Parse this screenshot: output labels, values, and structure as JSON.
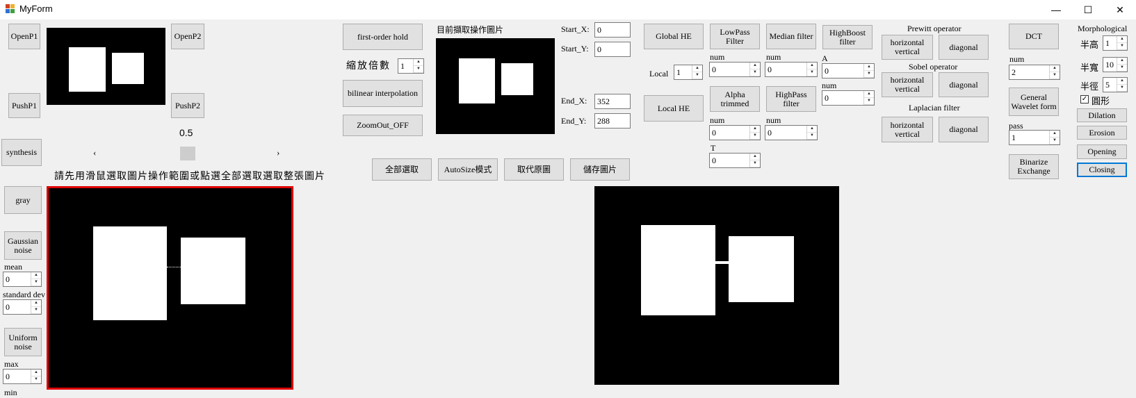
{
  "window": {
    "title": "MyForm",
    "minimize": "—",
    "maximize": "☐",
    "close": "✕"
  },
  "buttons": {
    "openp1": "OpenP1",
    "openp2": "OpenP2",
    "pushp1": "PushP1",
    "pushp2": "PushP2",
    "synthesis": "synthesis",
    "gray": "gray",
    "gaussian_noise": "Gaussian noise",
    "uniform_noise": "Uniform noise",
    "first_order_hold": "first-order hold",
    "bilinear": "bilinear interpolation",
    "zoomout": "ZoomOut_OFF",
    "select_all": "全部選取",
    "autosize": "AutoSize模式",
    "replace": "取代原圖",
    "save": "儲存圖片",
    "global_he": "Global HE",
    "local_he": "Local HE",
    "lowpass": "LowPass Filter",
    "median": "Median filter",
    "highboost": "HighBoost filter",
    "alpha_trimmed": "Alpha trimmed",
    "highpass": "HighPass filter",
    "prewitt_hv": "horizontal vertical",
    "prewitt_diag": "diagonal",
    "sobel_hv": "horizontal vertical",
    "sobel_diag": "diagonal",
    "laplacian_hv": "horizontal vertical",
    "laplacian_diag": "diagonal",
    "dct": "DCT",
    "wavelet": "General Wavelet form",
    "binarize": "Binarize Exchange",
    "dilation": "Dilation",
    "erosion": "Erosion",
    "opening": "Opening",
    "closing": "Closing"
  },
  "labels": {
    "scale": "縮放倍數",
    "current_image": "目前擷取操作圖片",
    "start_x": "Start_X:",
    "start_y": "Start_Y:",
    "end_x": "End_X:",
    "end_y": "End_Y:",
    "slider_value": "0.5",
    "hint": "請先用滑鼠選取圖片操作範圍或點選全部選取選取整張圖片",
    "mean": "mean",
    "std_dev": "standard dev",
    "max": "max",
    "min": "min",
    "local": "Local",
    "num1": "num",
    "num2": "num",
    "a": "A",
    "num3": "num",
    "num4": "num",
    "num5": "num",
    "t": "T",
    "prewitt": "Prewitt operator",
    "sobel": "Sobel operator",
    "laplacian": "Laplacian filter",
    "dct_num": "num",
    "pass": "pass",
    "morph": "Morphological",
    "half_h": "半高",
    "half_w": "半寬",
    "radius": "半徑",
    "shape": "圓形"
  },
  "values": {
    "scale": "1",
    "start_x": "0",
    "start_y": "0",
    "end_x": "352",
    "end_y": "288",
    "mean": "0",
    "std_dev": "0",
    "max": "0",
    "local": "1",
    "lowpass_num": "0",
    "median_num": "0",
    "highboost_a": "0",
    "highboost_num": "0",
    "alpha_num": "0",
    "highpass_num": "0",
    "t": "0",
    "dct_num": "2",
    "pass": "1",
    "half_h": "1",
    "half_w": "10",
    "radius": "5"
  },
  "colors": {
    "selection_border": "#e00000",
    "focus_border": "#0078d7"
  }
}
